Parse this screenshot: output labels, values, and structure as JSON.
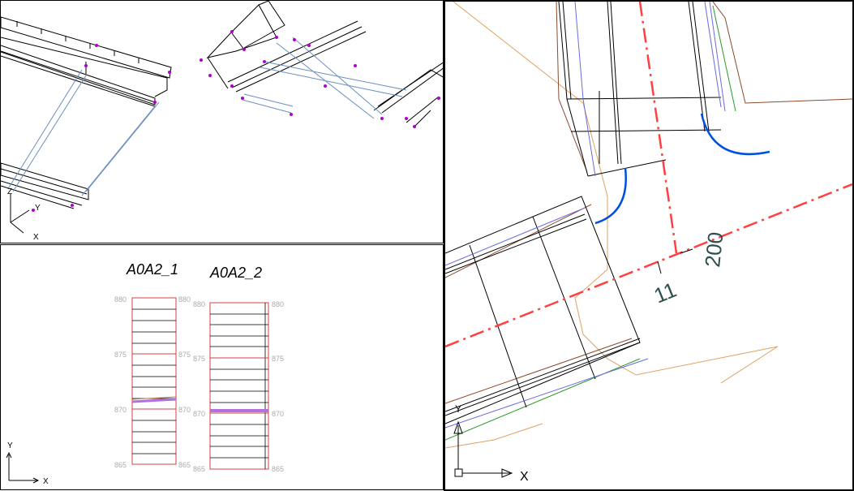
{
  "viewports": {
    "view3d": {
      "ucs": {
        "x": "X",
        "y": "Y",
        "z": "Z"
      }
    },
    "profiles": {
      "ucs": {
        "x": "X",
        "y": "Y"
      },
      "sections": [
        {
          "title": "A0A2_1",
          "ticks": [
            "880",
            "875",
            "870",
            "865"
          ]
        },
        {
          "title": "A0A2_2",
          "ticks": [
            "880",
            "875",
            "870",
            "865"
          ]
        }
      ]
    },
    "plan": {
      "ucs": {
        "x": "X",
        "y": "Y"
      },
      "dimensions": [
        "200",
        "11"
      ]
    }
  },
  "colors": {
    "wire": "#000000",
    "vertex": "#b000d0",
    "profile_grid": "#d04040",
    "profile_ground": "#b070e0",
    "centerline": "#ff4040",
    "curb_arc": "#0050e0",
    "terrain": "#e0a060",
    "dim_text": "#2f4f4f"
  },
  "icons": [
    "ucs-3d-icon",
    "ucs-2d-icon",
    "ucs-plan-icon"
  ]
}
